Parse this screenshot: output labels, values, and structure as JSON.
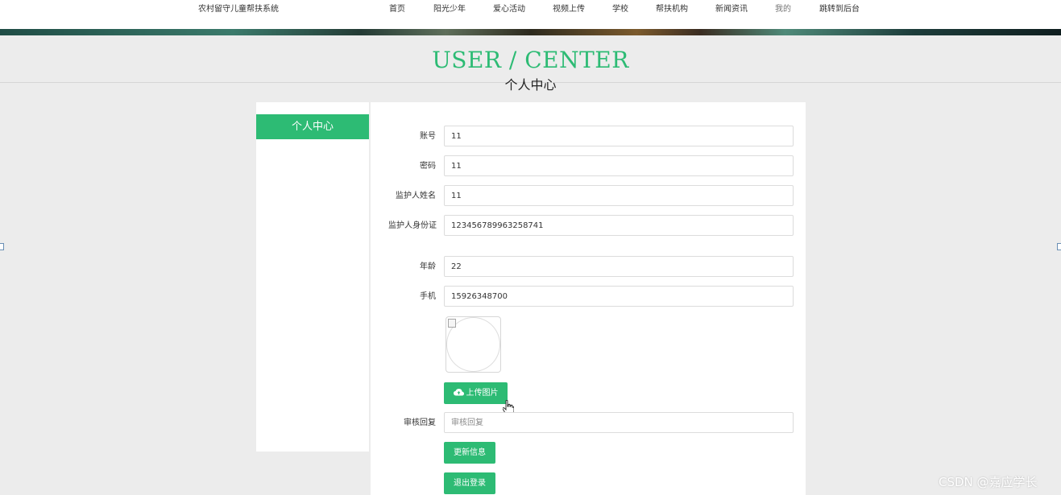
{
  "header": {
    "site_title": "农村留守儿童帮扶系统",
    "nav": [
      "首页",
      "阳光少年",
      "爱心活动",
      "视频上传",
      "学校",
      "帮扶机构",
      "新闻资讯",
      "我的",
      "跳转到后台"
    ]
  },
  "hero": {
    "title": "USER / CENTER",
    "subtitle": "个人中心"
  },
  "sidebar": {
    "active_item": "个人中心"
  },
  "form": {
    "fields": [
      {
        "label": "账号",
        "value": "11"
      },
      {
        "label": "密码",
        "value": "11"
      },
      {
        "label": "监护人姓名",
        "value": "11"
      },
      {
        "label": "监护人身份证",
        "value": "123456789963258741"
      },
      {
        "label": "年龄",
        "value": "22"
      },
      {
        "label": "手机",
        "value": "15926348700"
      }
    ],
    "upload_button": "上传图片",
    "review_reply": {
      "label": "审核回复",
      "placeholder": "审核回复"
    },
    "update_button": "更新信息",
    "logout_button": "退出登录"
  },
  "icons": {
    "upload": "cloud-upload-icon",
    "cursor": "hand-pointer-icon",
    "avatar": "broken-image-icon"
  },
  "colors": {
    "accent": "#2dbb74",
    "background": "#ececec"
  },
  "watermark": "CSDN @嘉应学长"
}
